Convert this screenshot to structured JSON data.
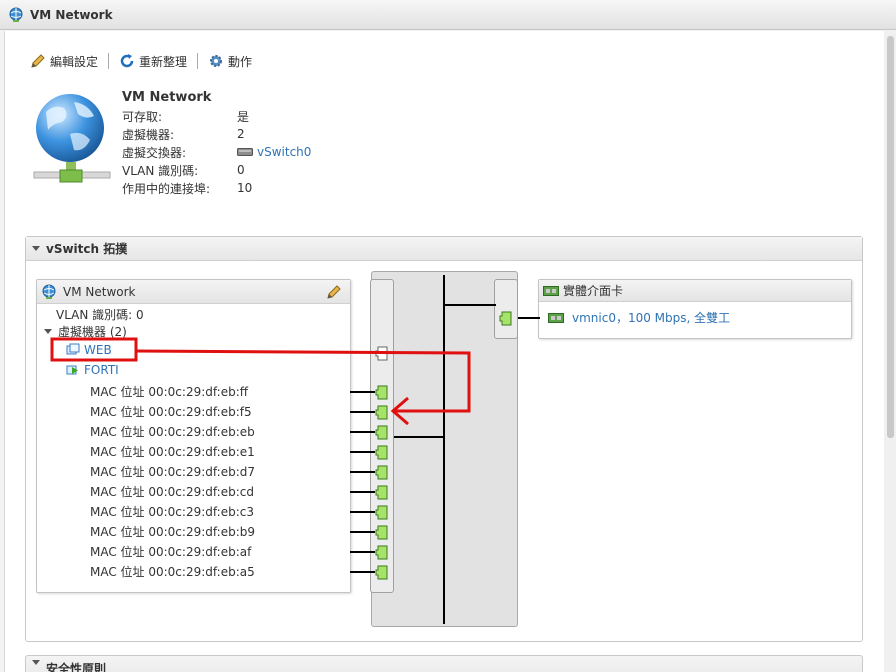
{
  "window": {
    "title": "VM Network"
  },
  "toolbar": {
    "edit": "編輯設定",
    "refresh": "重新整理",
    "actions": "動作"
  },
  "summary": {
    "name": "VM Network",
    "rows": [
      {
        "label": "可存取:",
        "value": "是"
      },
      {
        "label": "虛擬機器:",
        "value": "2"
      },
      {
        "label": "虛擬交換器:",
        "value": "vSwitch0"
      },
      {
        "label": "VLAN 識別碼:",
        "value": "0"
      },
      {
        "label": "作用中的連接埠:",
        "value": "10"
      }
    ]
  },
  "topology": {
    "title": "vSwitch 拓撲",
    "portgroup": {
      "title": "VM Network",
      "vlan": "VLAN 識別碼: 0",
      "vm_group": "虛擬機器 (2)",
      "vms": [
        "WEB",
        "FORTI"
      ],
      "macs": [
        "MAC 位址 00:0c:29:df:eb:ff",
        "MAC 位址 00:0c:29:df:eb:f5",
        "MAC 位址 00:0c:29:df:eb:eb",
        "MAC 位址 00:0c:29:df:eb:e1",
        "MAC 位址 00:0c:29:df:eb:d7",
        "MAC 位址 00:0c:29:df:eb:cd",
        "MAC 位址 00:0c:29:df:eb:c3",
        "MAC 位址 00:0c:29:df:eb:b9",
        "MAC 位址 00:0c:29:df:eb:af",
        "MAC 位址 00:0c:29:df:eb:a5"
      ]
    },
    "physical": {
      "title": "實體介面卡",
      "nic": "vmnic0，100 Mbps, 全雙工"
    }
  },
  "next_section": {
    "title": "安全性原則"
  },
  "colors": {
    "link": "#2f73b5",
    "port_green": "#a6e36a",
    "annotation_red": "#e01010"
  }
}
